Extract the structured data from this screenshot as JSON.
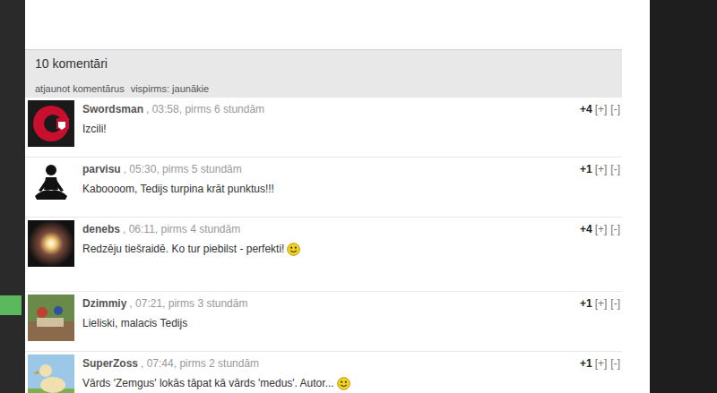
{
  "comments_header": {
    "count_label": "10 komentāri",
    "links": [
      "atjaunot komentārus",
      "vispirms: jaunākie"
    ]
  },
  "comments": [
    {
      "user": "Swordsman",
      "time": ", 03:58, pirms 6 stundām",
      "text": "Izcili!",
      "score": "+4",
      "vote_up": "[+]",
      "vote_down": "[-]",
      "kind": "logo",
      "smiley": false
    },
    {
      "user": "parvisu",
      "time": ", 05:30, pirms 5 stundām",
      "text": "Kaboooom, Tedijs turpina krāt punktus!!!",
      "score": "+1",
      "vote_up": "[+]",
      "vote_down": "[-]",
      "kind": "meditation",
      "smiley": false
    },
    {
      "user": "denebs",
      "time": ", 06:11, pirms 4 stundām",
      "text": "Redzēju tiešraidē. Ko tur piebilst - perfekti!",
      "score": "+4",
      "vote_up": "[+]",
      "vote_down": "[-]",
      "kind": "star",
      "smiley": true
    },
    {
      "user": "Dzimmiy",
      "time": ", 07:21, pirms 3 stundām",
      "text": "Lieliski, malacis Tedijs",
      "score": "+1",
      "vote_up": "[+]",
      "vote_down": "[-]",
      "kind": "photo",
      "smiley": false
    },
    {
      "user": "SuperZoss",
      "time": ", 07:44, pirms 2 stundām",
      "text": "Vārds 'Zemgus' lokās tāpat kā vārds 'medus'. Autor...",
      "score": "+1",
      "vote_up": "[+]",
      "vote_down": "[-]",
      "kind": "cartoon",
      "smiley": true
    }
  ]
}
